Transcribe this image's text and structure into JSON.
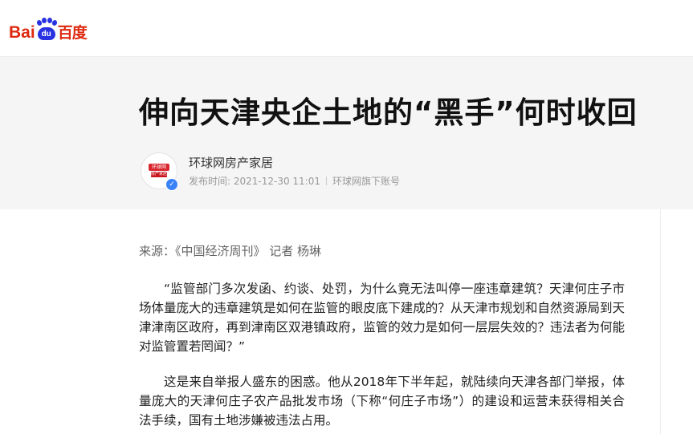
{
  "logo": {
    "text_en": "Bai",
    "paw_text": "du",
    "text_cn": "百度"
  },
  "article": {
    "title": "伸向天津央企土地的“黑手”何时收回",
    "author": "环球网房产家居",
    "publish_label": "发布时间: 2021-12-30 11:01",
    "account_type": "环球网旗下账号",
    "avatar_text_top": "环球网",
    "avatar_text_bottom": "房产家居",
    "source": "来源：《中国经济周刊》 记者 杨琳",
    "paragraphs": [
      "“监管部门多次发函、约谈、处罚，为什么竟无法叫停一座违章建筑？天津何庄子市场体量庞大的违章建筑是如何在监管的眼皮底下建成的？从天津市规划和自然资源局到天津津南区政府，再到津南区双港镇政府，监管的效力是如何一层层失效的？违法者为何能对监管置若罔闻？”",
      "这是来自举报人盛东的困惑。他从2018年下半年起，就陆续向天津各部门举报，体量庞大的天津何庄子农产品批发市场（下称“何庄子市场”）的建设和运营未获得相关合法手续，国有土地涉嫌被违法占用。"
    ]
  },
  "colors": {
    "brand_red": "#de2910",
    "brand_blue": "#2932e1",
    "header_bg": "#f5f5f5",
    "verified_blue": "#3a82f8"
  }
}
